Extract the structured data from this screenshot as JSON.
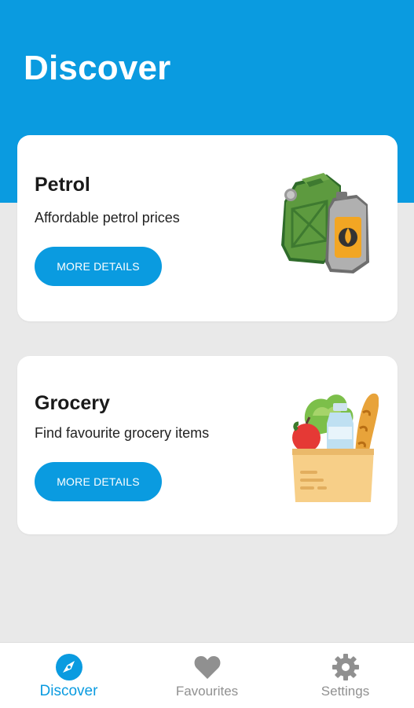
{
  "header": {
    "title": "Discover"
  },
  "cards": [
    {
      "title": "Petrol",
      "description": "Affordable petrol prices",
      "button_label": "MORE DETAILS",
      "illustration_icon": "fuel-jerrycan-icon"
    },
    {
      "title": "Grocery",
      "description": "Find favourite grocery items",
      "button_label": "MORE DETAILS",
      "illustration_icon": "grocery-bag-icon"
    }
  ],
  "bottom_nav": {
    "items": [
      {
        "label": "Discover",
        "icon": "compass-icon",
        "active": true
      },
      {
        "label": "Favourites",
        "icon": "heart-icon",
        "active": false
      },
      {
        "label": "Settings",
        "icon": "gear-icon",
        "active": false
      }
    ]
  },
  "colors": {
    "accent": "#0a9be0",
    "background": "#e9e9e9",
    "card": "#ffffff",
    "inactive": "#909090"
  }
}
